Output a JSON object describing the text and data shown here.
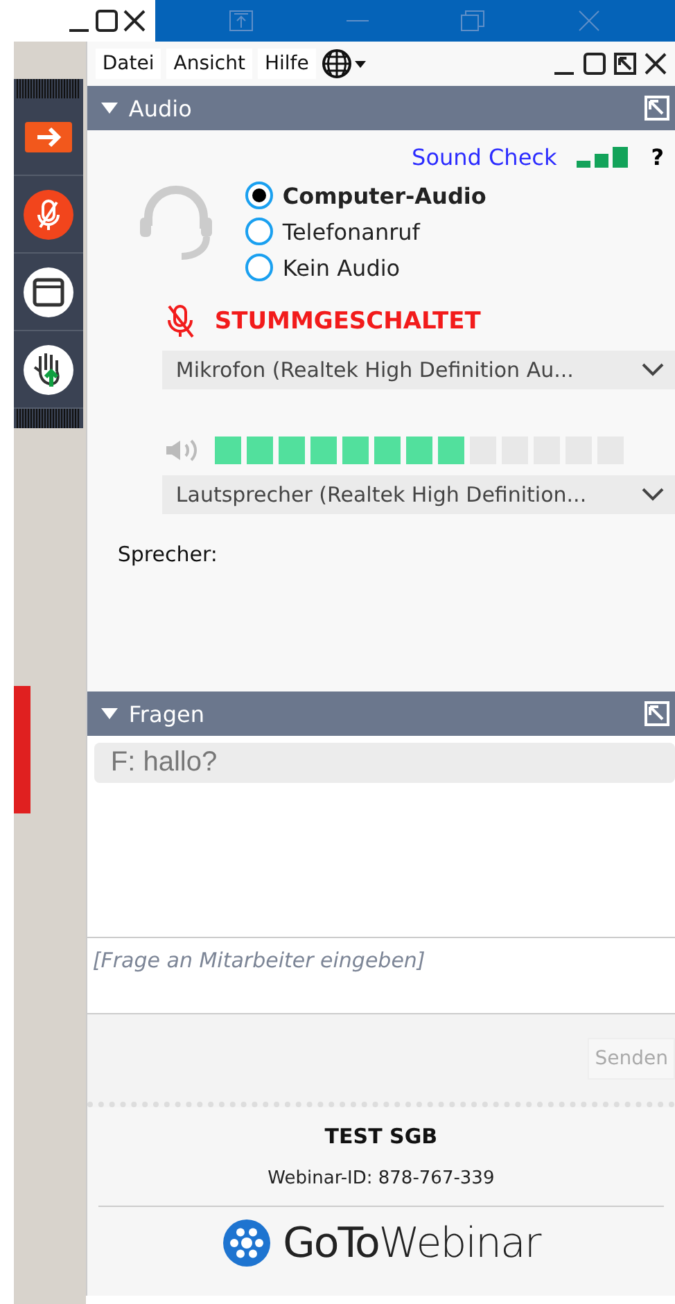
{
  "menu": [
    "Datei",
    "Ansicht",
    "Hilfe"
  ],
  "audio": {
    "title": "Audio",
    "sound_check": "Sound Check",
    "help": "?",
    "muted": true,
    "options": [
      {
        "label": "Computer-Audio",
        "selected": true
      },
      {
        "label": "Telefonanruf",
        "selected": false
      },
      {
        "label": "Kein Audio",
        "selected": false
      }
    ],
    "muted_label": "STUMMGESCHALTET",
    "microphone": "Mikrofon (Realtek High Definition Au...",
    "level": 0.61,
    "speaker": "Lautsprecher (Realtek High Definition...",
    "speaker_label": "Sprecher:"
  },
  "questions": {
    "title": "Fragen",
    "items": [
      "F: hallo?"
    ],
    "placeholder": "[Frage an Mitarbeiter eingeben]",
    "send": {
      "label": "Senden",
      "disabled": true
    }
  },
  "footer": {
    "title": "TEST SGB",
    "webinar_id": "Webinar-ID: 878-767-339",
    "logo": "**GoTo**Webinar"
  }
}
